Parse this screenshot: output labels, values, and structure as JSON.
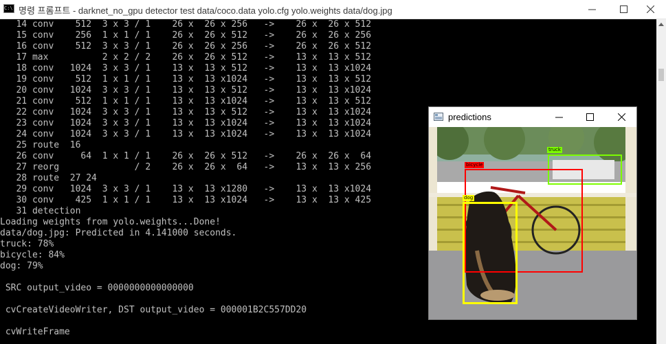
{
  "window": {
    "title": "명령 프롬프트 - darknet_no_gpu  detector test data/coco.data yolo.cfg yolo.weights data/dog.jpg",
    "icon": "cmd-icon",
    "controls": [
      "minimize",
      "maximize",
      "close"
    ]
  },
  "console": {
    "lines": [
      "   14 conv    512  3 x 3 / 1    26 x  26 x 256   ->    26 x  26 x 512",
      "   15 conv    256  1 x 1 / 1    26 x  26 x 512   ->    26 x  26 x 256",
      "   16 conv    512  3 x 3 / 1    26 x  26 x 256   ->    26 x  26 x 512",
      "   17 max          2 x 2 / 2    26 x  26 x 512   ->    13 x  13 x 512",
      "   18 conv   1024  3 x 3 / 1    13 x  13 x 512   ->    13 x  13 x1024",
      "   19 conv    512  1 x 1 / 1    13 x  13 x1024   ->    13 x  13 x 512",
      "   20 conv   1024  3 x 3 / 1    13 x  13 x 512   ->    13 x  13 x1024",
      "   21 conv    512  1 x 1 / 1    13 x  13 x1024   ->    13 x  13 x 512",
      "   22 conv   1024  3 x 3 / 1    13 x  13 x 512   ->    13 x  13 x1024",
      "   23 conv   1024  3 x 3 / 1    13 x  13 x1024   ->    13 x  13 x1024",
      "   24 conv   1024  3 x 3 / 1    13 x  13 x1024   ->    13 x  13 x1024",
      "   25 route  16",
      "   26 conv     64  1 x 1 / 1    26 x  26 x 512   ->    26 x  26 x  64",
      "   27 reorg              / 2    26 x  26 x  64   ->    13 x  13 x 256",
      "   28 route  27 24",
      "   29 conv   1024  3 x 3 / 1    13 x  13 x1280   ->    13 x  13 x1024",
      "   30 conv    425  1 x 1 / 1    13 x  13 x1024   ->    13 x  13 x 425",
      "   31 detection",
      "Loading weights from yolo.weights...Done!",
      "data/dog.jpg: Predicted in 4.141000 seconds.",
      "truck: 78%",
      "bicycle: 84%",
      "dog: 79%",
      "",
      " SRC output_video = 0000000000000000",
      "",
      " cvCreateVideoWriter, DST output_video = 000001B2C557DD20",
      "",
      " cvWriteFrame"
    ]
  },
  "predictions_window": {
    "title": "predictions",
    "detections": [
      {
        "label": "truck",
        "color": "#7cfc00"
      },
      {
        "label": "bicycle",
        "color": "#ff0000"
      },
      {
        "label": "dog",
        "color": "#ffff00"
      }
    ]
  },
  "colors": {
    "console_bg": "#000000",
    "console_text": "#c0c0c0"
  }
}
